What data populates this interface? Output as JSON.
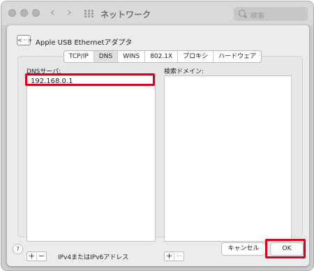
{
  "window": {
    "title": "ネットワーク"
  },
  "search": {
    "placeholder": "検索"
  },
  "device": {
    "name": "Apple USB Ethernetアダプタ",
    "icon_text": "<···>"
  },
  "tabs": [
    {
      "label": "TCP/IP",
      "active": false
    },
    {
      "label": "DNS",
      "active": true
    },
    {
      "label": "WINS",
      "active": false
    },
    {
      "label": "802.1X",
      "active": false
    },
    {
      "label": "プロキシ",
      "active": false
    },
    {
      "label": "ハードウェア",
      "active": false
    }
  ],
  "dns": {
    "label": "DNSサーバ:",
    "entries": [
      "192.168.0.1"
    ],
    "hint": "IPv4またはIPv6アドレス"
  },
  "search_domains": {
    "label": "検索ドメイン:"
  },
  "controls": {
    "add": "+",
    "remove": "−"
  },
  "footer": {
    "help": "?",
    "cancel": "キャンセル",
    "ok": "OK"
  },
  "highlight_color": "#d9001b"
}
